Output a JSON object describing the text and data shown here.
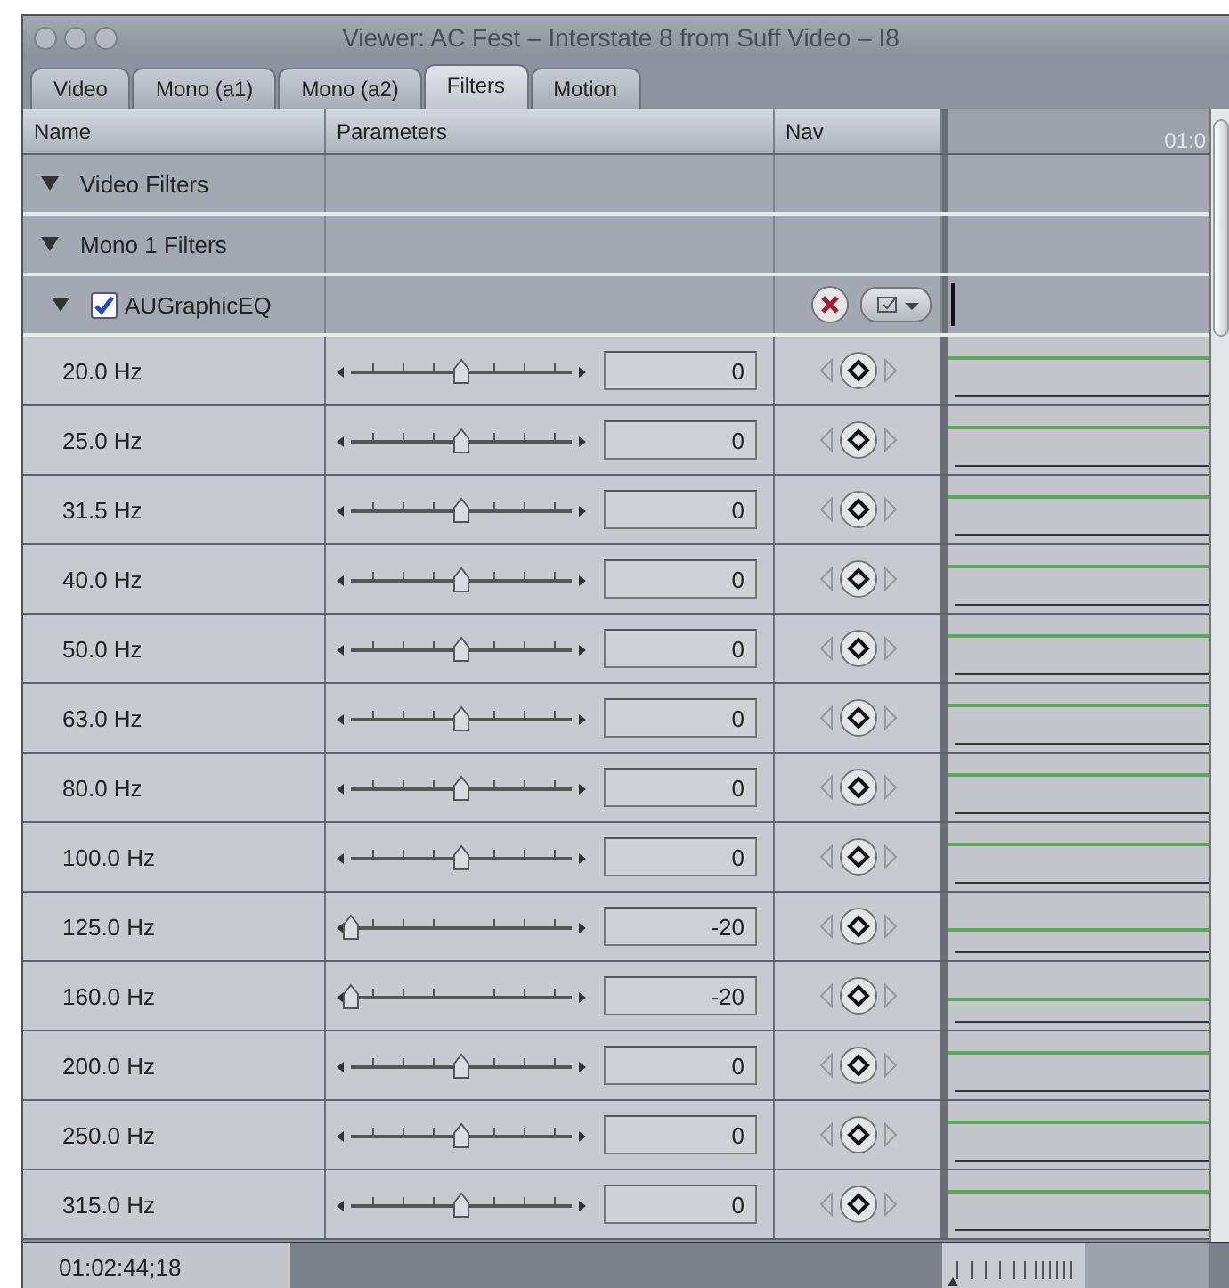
{
  "window": {
    "title": "Viewer: AC Fest – Interstate 8 from Suff Video – I8"
  },
  "tabs": [
    {
      "label": "Video",
      "selected": false
    },
    {
      "label": "Mono (a1)",
      "selected": false
    },
    {
      "label": "Mono (a2)",
      "selected": false
    },
    {
      "label": "Filters",
      "selected": true
    },
    {
      "label": "Motion",
      "selected": false
    }
  ],
  "columns": [
    "Name",
    "Parameters",
    "Nav"
  ],
  "timeline": {
    "ruler_label": "01:0"
  },
  "groups": [
    {
      "label": "Video Filters",
      "expanded": true
    },
    {
      "label": "Mono 1 Filters",
      "expanded": true
    }
  ],
  "filter": {
    "name": "AUGraphicEQ",
    "expanded": true,
    "enabled": true
  },
  "bands": [
    {
      "name": "20.0 Hz",
      "level": 0.5,
      "value": "0"
    },
    {
      "name": "25.0 Hz",
      "level": 0.5,
      "value": "0"
    },
    {
      "name": "31.5 Hz",
      "level": 0.5,
      "value": "0"
    },
    {
      "name": "40.0 Hz",
      "level": 0.5,
      "value": "0"
    },
    {
      "name": "50.0 Hz",
      "level": 0.5,
      "value": "0"
    },
    {
      "name": "63.0 Hz",
      "level": 0.5,
      "value": "0"
    },
    {
      "name": "80.0 Hz",
      "level": 0.5,
      "value": "0"
    },
    {
      "name": "100.0 Hz",
      "level": 0.5,
      "value": "0"
    },
    {
      "name": "125.0 Hz",
      "level": 0,
      "value": "-20"
    },
    {
      "name": "160.0 Hz",
      "level": 0,
      "value": "-20"
    },
    {
      "name": "200.0 Hz",
      "level": 0.5,
      "value": "0"
    },
    {
      "name": "250.0 Hz",
      "level": 0.5,
      "value": "0"
    },
    {
      "name": "315.0 Hz",
      "level": 0.5,
      "value": "0"
    }
  ],
  "timecode": "01:02:44;18"
}
